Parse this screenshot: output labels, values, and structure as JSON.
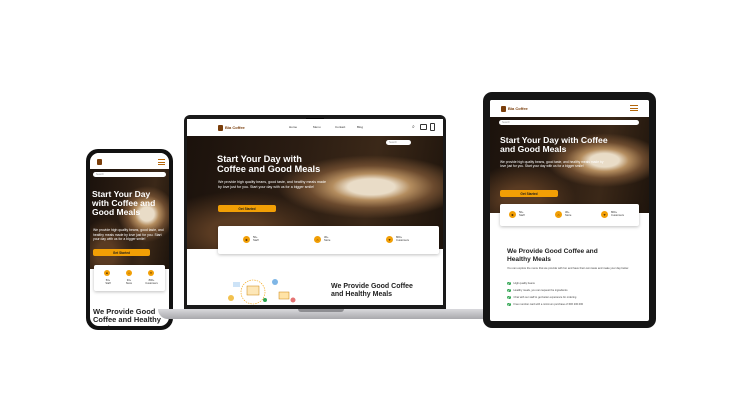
{
  "brand": {
    "name": "Bia Coffee"
  },
  "nav": {
    "items": [
      "Home",
      "Menu",
      "Contact",
      "Blog"
    ]
  },
  "search": {
    "placeholder": "Search"
  },
  "hero": {
    "title": "Start Your Day with Coffee and Good Meals",
    "text": "We provide high quality beans, good taste, and healthy meals made by love just for you. Start your day with us for a bigger smile!",
    "cta": "Get Started"
  },
  "stats": [
    {
      "value": "50+",
      "label": "Staff"
    },
    {
      "value": "30+",
      "label": "Store"
    },
    {
      "value": "800+",
      "label": "Customers"
    }
  ],
  "about": {
    "title": "We Provide Good Coffee and Healthy Meals",
    "text": "You can explore the menu that we provide with fun and have their own taste and make your day better.",
    "features": [
      "High quality beans",
      "Healthy meals, you can request the ingredients",
      "Chat with our staff to get better experience for ordering",
      "Free member card with a minimum purchase of IDR 200.000"
    ]
  },
  "colors": {
    "accent": "#f29f05",
    "dark": "#1b120c",
    "brand": "#7a3e0b"
  }
}
